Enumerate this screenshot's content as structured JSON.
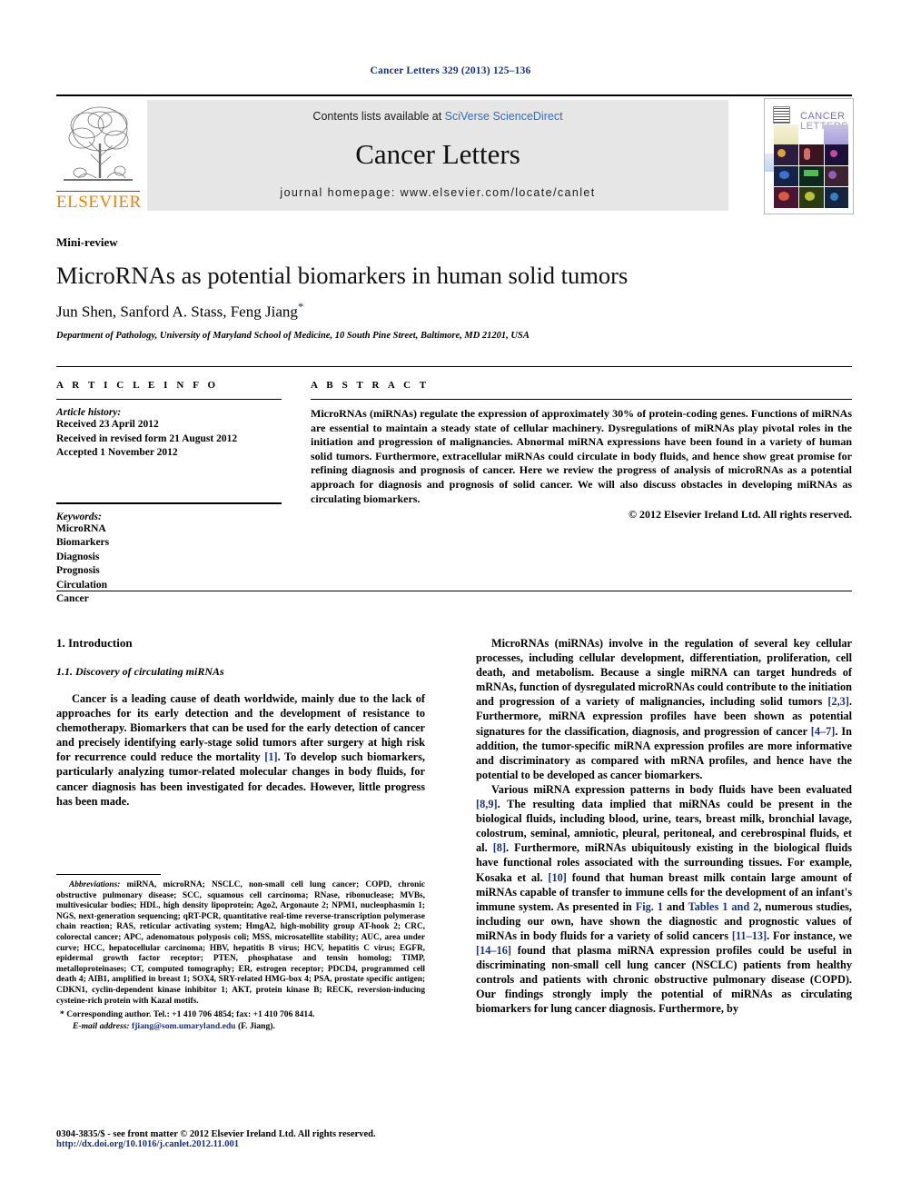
{
  "running_head": "Cancer Letters 329 (2013) 125–136",
  "masthead": {
    "publisher_name": "ELSEVIER",
    "contents_prefix": "Contents lists available at ",
    "sciencedirect_link": "SciVerse ScienceDirect",
    "journal_title": "Cancer Letters",
    "homepage": "journal homepage: www.elsevier.com/locate/canlet",
    "cover": {
      "line1": "CANCER",
      "line2": "LETTERS"
    }
  },
  "article": {
    "type_label": "Mini-review",
    "title": "MicroRNAs as potential biomarkers in human solid tumors",
    "authors": "Jun Shen, Sanford A. Stass, Feng Jiang",
    "corresponding_marker": "*",
    "affiliation": "Department of Pathology, University of Maryland School of Medicine, 10 South Pine Street, Baltimore, MD 21201, USA"
  },
  "article_info": {
    "heading": "A R T I C L E   I N F O",
    "history_label": "Article history:",
    "history": [
      "Received 23 April 2012",
      "Received in revised form 21 August 2012",
      "Accepted 1 November 2012"
    ],
    "keywords_label": "Keywords:",
    "keywords": [
      "MicroRNA",
      "Biomarkers",
      "Diagnosis",
      "Prognosis",
      "Circulation",
      "Cancer"
    ]
  },
  "abstract": {
    "heading": "A B S T R A C T",
    "text": "MicroRNAs (miRNAs) regulate the expression of approximately 30% of protein-coding genes. Functions of miRNAs are essential to maintain a steady state of cellular machinery. Dysregulations of miRNAs play pivotal roles in the initiation and progression of malignancies. Abnormal miRNA expressions have been found in a variety of human solid tumors. Furthermore, extracellular miRNAs could circulate in body fluids, and hence show great promise for refining diagnosis and prognosis of cancer. Here we review the progress of analysis of microRNAs as a potential approach for diagnosis and prognosis of solid cancer. We will also discuss obstacles in developing miRNAs as circulating biomarkers.",
    "copyright": "© 2012 Elsevier Ireland Ltd. All rights reserved."
  },
  "body": {
    "section_heading": "1. Introduction",
    "subsection_heading": "1.1. Discovery of circulating miRNAs",
    "left_paragraph_1_a": "Cancer is a leading cause of death worldwide, mainly due to the lack of approaches for its early detection and the development of resistance to chemotherapy. Biomarkers that can be used for the early detection of cancer and precisely identifying early-stage solid tumors after surgery at high risk for recurrence could reduce the mortality ",
    "left_paragraph_1_cit": "[1]",
    "left_paragraph_1_b": ". To develop such biomarkers, particularly analyzing tumor-related molecular changes in body fluids, for cancer diagnosis has been investigated for decades. However, little progress has been made.",
    "right_p1_a": "MicroRNAs (miRNAs) involve in the regulation of several key cellular processes, including cellular development, differentiation, proliferation, cell death, and metabolism. Because a single miRNA can target hundreds of mRNAs, function of dysregulated microRNAs could contribute to the initiation and progression of a variety of malignancies, including solid tumors ",
    "right_p1_cit1": "[2,3]",
    "right_p1_b": ". Furthermore, miRNA expression profiles have been shown as potential signatures for the classification, diagnosis, and progression of cancer ",
    "right_p1_cit2": "[4–7]",
    "right_p1_c": ". In addition, the tumor-specific miRNA expression profiles are more informative and discriminatory as compared with mRNA profiles, and hence have the potential to be developed as cancer biomarkers.",
    "right_p2_a": "Various miRNA expression patterns in body fluids have been evaluated ",
    "right_p2_cit1": "[8,9]",
    "right_p2_b": ". The resulting data implied that miRNAs could be present in the biological fluids, including blood, urine, tears, breast milk, bronchial lavage, colostrum, seminal, amniotic, pleural, peritoneal, and cerebrospinal fluids, et al. ",
    "right_p2_cit2": "[8]",
    "right_p2_c": ". Furthermore, miRNAs ubiquitously existing in the biological fluids have functional roles associated with the surrounding tissues. For example, Kosaka et al. ",
    "right_p2_cit3": "[10]",
    "right_p2_d": " found that human breast milk contain large amount of miRNAs capable of transfer to immune cells for the development of an infant's immune system. As presented in ",
    "right_p2_ref1": "Fig. 1",
    "right_p2_e": " and ",
    "right_p2_ref2": "Tables 1 and 2",
    "right_p2_f": ", numerous studies, including our own, have shown the diagnostic and prognostic values of miRNAs in body fluids for a variety of solid cancers ",
    "right_p2_cit4": "[11–13]",
    "right_p2_g": ". For instance, we ",
    "right_p2_cit5": "[14–16]",
    "right_p2_h": " found that plasma miRNA expression profiles could be useful in discriminating non-small cell lung cancer (NSCLC) patients from healthy controls and patients with chronic obstructive pulmonary disease (COPD). Our findings strongly imply the potential of miRNAs as circulating biomarkers for lung cancer diagnosis. Furthermore, by"
  },
  "footnotes": {
    "abbreviations_label": "Abbreviations:",
    "abbreviations_text": " miRNA, microRNA; NSCLC, non-small cell lung cancer; COPD, chronic obstructive pulmonary disease; SCC, squamous cell carcinoma; RNase, ribonuclease; MVBs, multivesicular bodies; HDL, high density lipoprotein; Ago2, Argonaute 2; NPM1, nucleophasmin 1; NGS, next-generation sequencing; qRT-PCR, quantitative real-time reverse-transcription polymerase chain reaction; RAS, reticular activating system; HmgA2, high-mobility group AT-hook 2; CRC, colorectal cancer; APC, adenomatous polyposis coli; MSS, microsatellite stability; AUC, area under curve; HCC, hepatocellular carcinoma; HBV, hepatitis B virus; HCV, hepatitis C virus; EGFR, epidermal growth factor receptor; PTEN, phosphatase and tensin homolog; TIMP, metalloproteinases; CT, computed tomography; ER, estrogen receptor; PDCD4, programmed cell death 4; AIB1, amplified in breast 1; SOX4, SRY-related HMG-box 4; PSA, prostate specific antigen; CDKN1, cyclin-dependent kinase inhibitor 1; AKT, protein kinase B; RECK, reversion-inducing cysteine-rich protein with Kazal motifs.",
    "corresponding_marker": "*",
    "corresponding_text": "Corresponding author. Tel.: +1 410 706 4854; fax: +1 410 706 8414.",
    "email_label": "E-mail address:",
    "email": "fjiang@som.umaryland.edu",
    "email_suffix": "(F. Jiang)."
  },
  "footer": {
    "issn_line": "0304-3835/$ - see front matter © 2012 Elsevier Ireland Ltd. All rights reserved.",
    "doi": "http://dx.doi.org/10.1016/j.canlet.2012.11.001"
  },
  "colors": {
    "link_blue": "#17317f",
    "sciencedirect_blue": "#2f6fba",
    "elsevier_orange": "#f08000",
    "banner_gray": "#e6e6e6"
  }
}
